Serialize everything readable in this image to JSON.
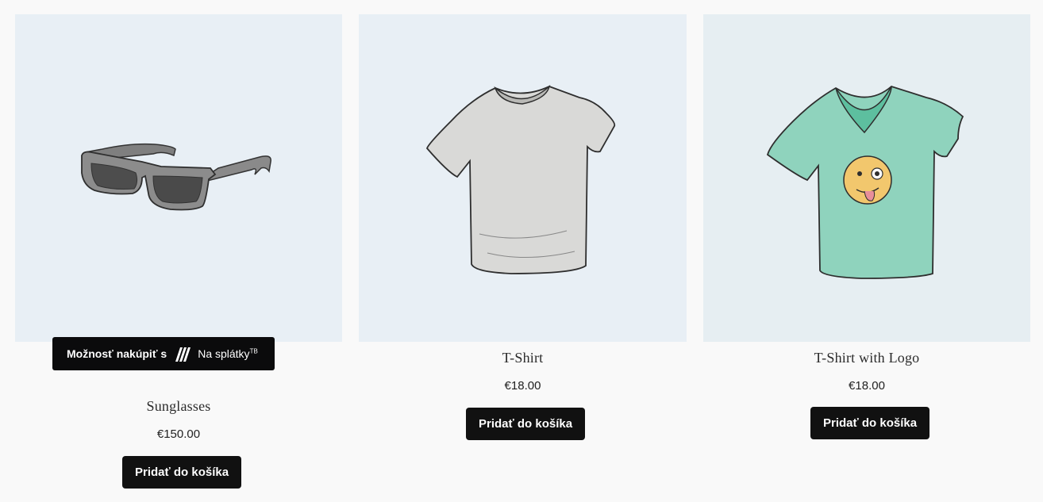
{
  "products": [
    {
      "title": "Sunglasses",
      "price": "€150.00",
      "button": "Pridať do košíka",
      "image_icon": "sunglasses-icon"
    },
    {
      "title": "T-Shirt",
      "price": "€18.00",
      "button": "Pridať do košíka",
      "image_icon": "tshirt-icon"
    },
    {
      "title": "T-Shirt with Logo",
      "price": "€18.00",
      "button": "Pridať do košíka",
      "image_icon": "tshirt-logo-icon"
    }
  ],
  "installments_banner": {
    "lead": "Možnosť nakúpiť s",
    "brand": "Na splátky",
    "brand_sup": "TB",
    "logo_icon": "tatra-banka-logo-icon"
  },
  "colors": {
    "page_bg": "#f9f9f9",
    "image_bg": "#e8eff5",
    "button_bg": "#111111",
    "button_text": "#ffffff"
  }
}
